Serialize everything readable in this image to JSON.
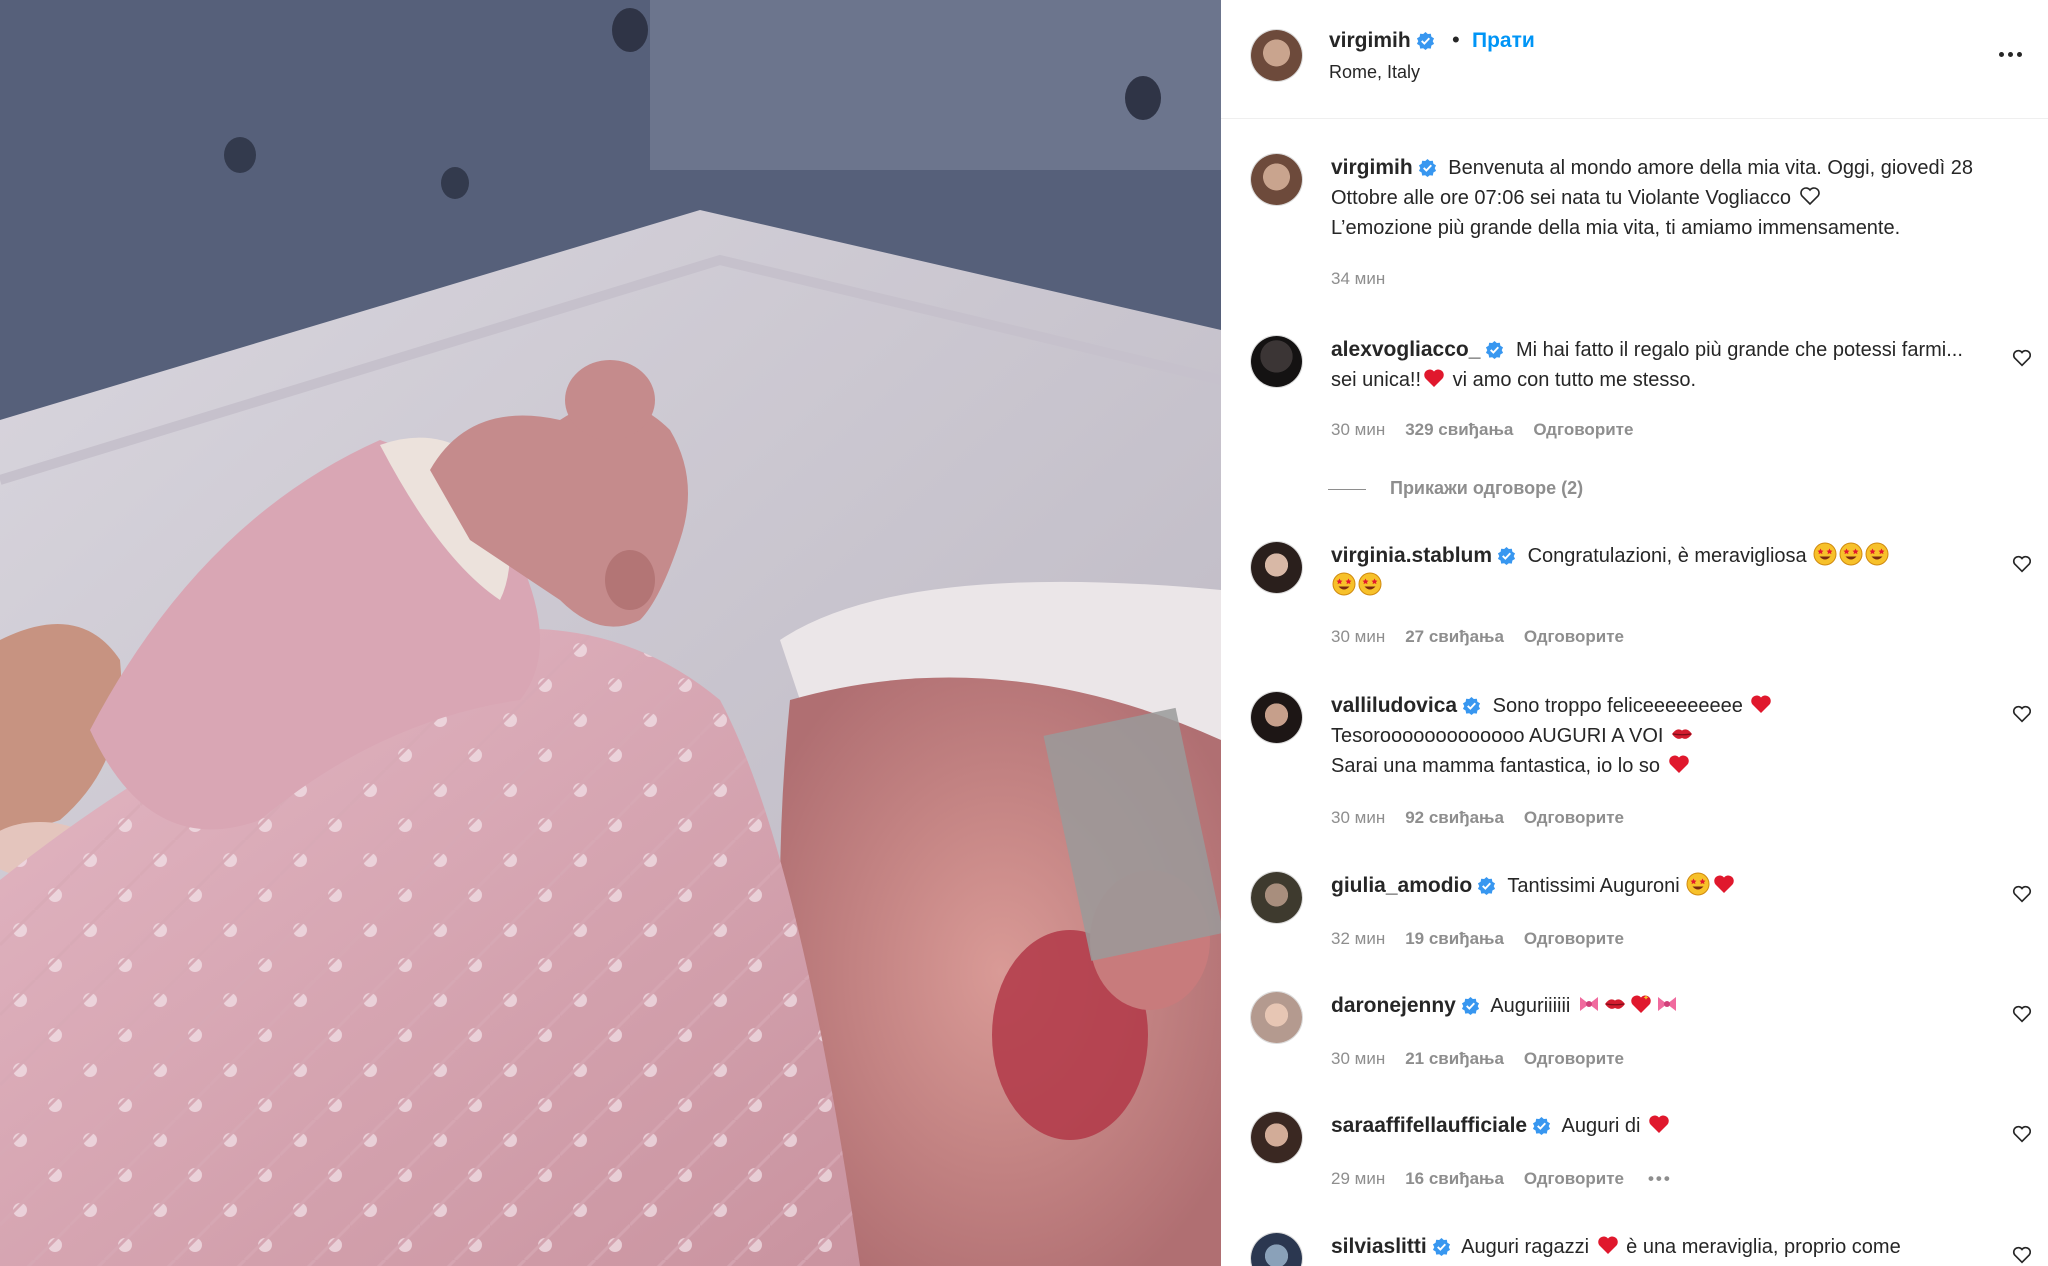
{
  "post": {
    "author": "virgimih",
    "follow_label": "Прати",
    "location": "Rome, Italy",
    "caption": {
      "username": "virgimih",
      "text": "Benvenuta al mondo amore della mia vita. Oggi, giovedì 28 Ottobre alle ore 07:06 sei nata tu Violante Vogliacco",
      "text2": "L’emozione più grande della mia vita, ti amiamo immensamente.",
      "time": "34 мин"
    },
    "image_description_icon": "newborn-photo"
  },
  "comments": [
    {
      "username": "alexvogliacco_",
      "text": "Mi hai fatto il regalo più grande che potessi farmi... sei unica!!",
      "text_after": " vi amo con tutto me stesso.",
      "time": "30 мин",
      "likes": "329 свиђања",
      "reply": "Одговорите",
      "view_replies": "Прикажи одговоре (2)"
    },
    {
      "username": "virginia.stablum",
      "text": "Congratulazioni, è meravigliosa",
      "time": "30 мин",
      "likes": "27 свиђања",
      "reply": "Одговорите"
    },
    {
      "username": "valliludovica",
      "line1": "Sono troppo feliceeeeeeeee",
      "line2": "Tesorooooooooooooo AUGURI A VOI",
      "line3": "Sarai una mamma fantastica, io lo so",
      "time": "30 мин",
      "likes": "92 свиђања",
      "reply": "Одговорите"
    },
    {
      "username": "giulia_amodio",
      "text": "Tantissimi Auguroni",
      "time": "32 мин",
      "likes": "19 свиђања",
      "reply": "Одговорите"
    },
    {
      "username": "daronejenny",
      "text": "Auguriiiiii",
      "time": "30 мин",
      "likes": "21 свиђања",
      "reply": "Одговорите"
    },
    {
      "username": "saraaffifellaufficiale",
      "text": "Auguri di",
      "time": "29 мин",
      "likes": "16 свиђања",
      "reply": "Одговорите",
      "more": "•••"
    },
    {
      "username": "silviaslitti",
      "text": "Auguri ragazzi",
      "text_after": " è una meraviglia, proprio come"
    }
  ],
  "colors": {
    "accent": "#0095f6",
    "verified": "#3897f0",
    "secondary_text": "#8e8e8e",
    "heart_red": "#e0182d"
  }
}
